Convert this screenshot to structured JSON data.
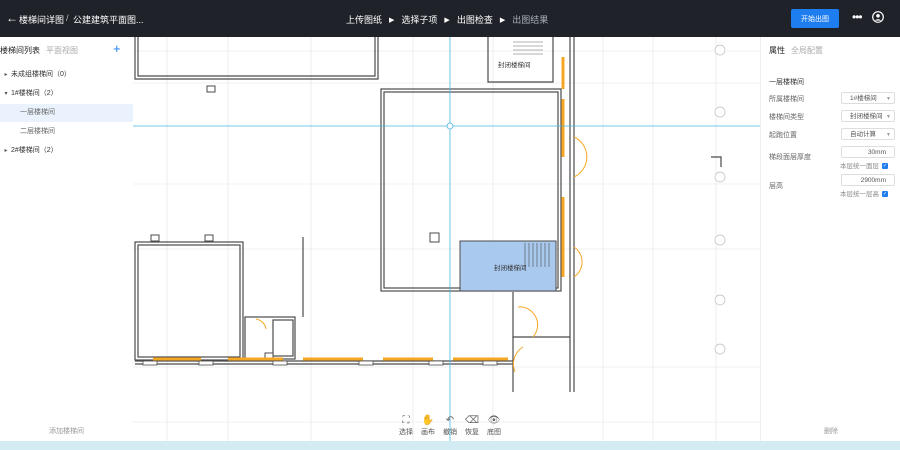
{
  "header": {
    "back_icon": "arrow-left-icon",
    "title": "楼梯间详图",
    "separator": "/",
    "file_name": "公建建筑平面图...",
    "steps": [
      {
        "label": "上传图纸",
        "state": "done"
      },
      {
        "label": "选择子项",
        "state": "done"
      },
      {
        "label": "出图检查",
        "state": "current"
      },
      {
        "label": "出图结果",
        "state": "pending"
      }
    ],
    "primary_button": "开始出图",
    "more_icon": "more-icon",
    "user_icon": "user-icon"
  },
  "left_panel": {
    "tab_active": "楼梯间列表",
    "tab_inactive": "平面视图",
    "add_icon": "plus-icon",
    "tree": [
      {
        "label": "未成组楼梯间（0）",
        "level": 0,
        "expanded": false
      },
      {
        "label": "1#楼梯间（2）",
        "level": 0,
        "expanded": true
      },
      {
        "label": "一层楼梯间",
        "level": 1,
        "selected": true
      },
      {
        "label": "二层楼梯间",
        "level": 1,
        "selected": false
      },
      {
        "label": "2#楼梯间（2）",
        "level": 0,
        "expanded": false
      }
    ],
    "footer": "添加楼梯间"
  },
  "canvas": {
    "room_labels": [
      "封闭楼梯间",
      "封闭楼梯间"
    ],
    "toolbar": [
      {
        "label": "选择",
        "icon": "select-icon"
      },
      {
        "label": "画布",
        "icon": "hand-icon"
      },
      {
        "label": "撤销",
        "icon": "undo-icon"
      },
      {
        "label": "恢复",
        "icon": "redo-icon"
      },
      {
        "label": "底图",
        "icon": "eye-icon"
      }
    ]
  },
  "right_panel": {
    "tab_active": "属性",
    "tab_inactive": "全局配置",
    "section_title": "一层楼梯间",
    "props": {
      "stair_label": "所属楼梯间",
      "stair_value": "1#楼梯间",
      "type_label": "楼梯间类型",
      "type_value": "封闭楼梯间",
      "start_label": "起跑位置",
      "start_value": "自动计算",
      "thickness_label": "梯段面层厚度",
      "thickness_value": "30mm",
      "thickness_check": "本层统一面层",
      "height_label": "层高",
      "height_value": "2900mm",
      "height_check": "本层统一层高"
    },
    "footer": "删除"
  },
  "colors": {
    "topbar": "#1f2329",
    "primary": "#1e7ef0",
    "highlight_room": "#a9c9ee",
    "orange_door": "#f5a623",
    "guide_line": "#48b5e0"
  }
}
